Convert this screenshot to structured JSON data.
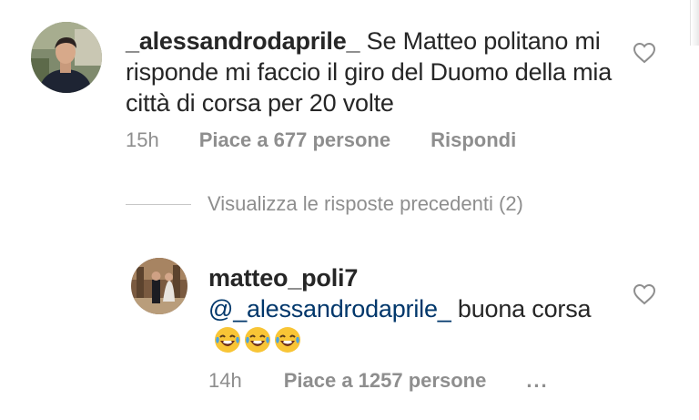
{
  "comments": [
    {
      "username": "_alessandrodaprile_",
      "text": "Se Matteo politano mi risponde mi faccio il giro del Duomo della mia città di corsa per 20 volte",
      "time": "15h",
      "likes": "Piace a 677 persone",
      "reply": "Rispondi",
      "avatar": "user-avatar-photo",
      "like_icon": "heart-outline-icon"
    },
    {
      "username": "matteo_poli7",
      "mention": "@_alessandrodaprile_",
      "text": "buona corsa",
      "emoji": [
        "😂",
        "😂",
        "😂"
      ],
      "time": "14h",
      "likes": "Piace a 1257 persone",
      "more": "...",
      "avatar": "user-avatar-photo",
      "like_icon": "heart-outline-icon"
    }
  ],
  "replies_toggle": {
    "label": "Visualizza le risposte precedenti (2)"
  },
  "colors": {
    "text": "#262626",
    "secondary": "#8e8e8e",
    "mention": "#00376b",
    "divider": "#c7c7c7"
  }
}
